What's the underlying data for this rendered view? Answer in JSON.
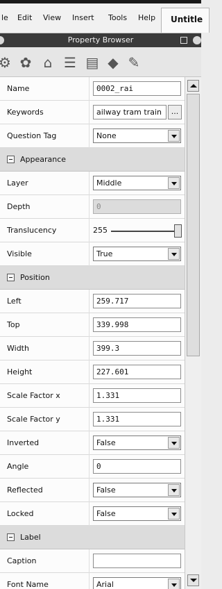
{
  "menubar": {
    "items": [
      "le",
      "Edit",
      "View",
      "Insert",
      "Tools",
      "Help"
    ],
    "doc_tab": "Untitle"
  },
  "panel": {
    "title": "Property Browser",
    "toolbar_icons": [
      "settings-gears-icon",
      "style-brush-icon",
      "house-icon",
      "lines-icon",
      "document-icon",
      "spinning-top-icon",
      "pencil-icon"
    ]
  },
  "properties": {
    "name": {
      "label": "Name",
      "value": "0002_rai"
    },
    "keywords": {
      "label": "Keywords",
      "value": "ailway tram train",
      "button": "..."
    },
    "question_tag": {
      "label": "Question Tag",
      "value": "None"
    },
    "appearance_section": "Appearance",
    "layer": {
      "label": "Layer",
      "value": "Middle"
    },
    "depth": {
      "label": "Depth",
      "value": "0"
    },
    "translucency": {
      "label": "Translucency",
      "value": "255",
      "level": 1.0
    },
    "visible": {
      "label": "Visible",
      "value": "True"
    },
    "position_section": "Position",
    "left": {
      "label": "Left",
      "value": "259.717"
    },
    "top": {
      "label": "Top",
      "value": "339.998"
    },
    "width": {
      "label": "Width",
      "value": "399.3"
    },
    "height": {
      "label": "Height",
      "value": "227.601"
    },
    "scale_x": {
      "label": "Scale Factor x",
      "value": "1.331"
    },
    "scale_y": {
      "label": "Scale Factor y",
      "value": "1.331"
    },
    "inverted": {
      "label": "Inverted",
      "value": "False"
    },
    "angle": {
      "label": "Angle",
      "value": "0"
    },
    "reflected": {
      "label": "Reflected",
      "value": "False"
    },
    "locked": {
      "label": "Locked",
      "value": "False"
    },
    "label_section": "Label",
    "caption": {
      "label": "Caption",
      "value": ""
    },
    "font_name": {
      "label": "Font Name",
      "value": "Arial"
    }
  }
}
